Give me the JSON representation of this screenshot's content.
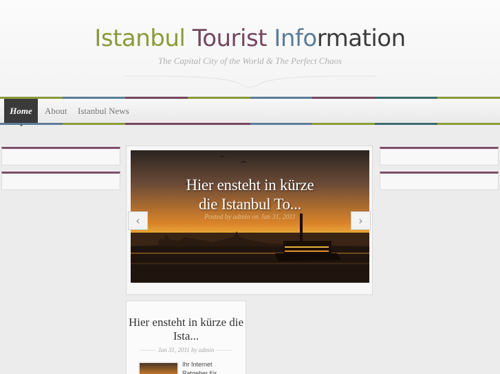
{
  "header": {
    "title_parts": [
      "Istanbul",
      "Tourist",
      "Info",
      "rmation"
    ],
    "tagline": "The Capital City of the World & The Perfect Chaos"
  },
  "nav": {
    "items": [
      {
        "label": "Home"
      },
      {
        "label": "About"
      },
      {
        "label": "Istanbul News"
      }
    ]
  },
  "slider": {
    "title_line1": "Hier ensteht in kürze",
    "title_line2": "die Istanbul To...",
    "meta": "Posted by admin on Jan 31, 2011",
    "prev_icon": "chevron-left-icon",
    "next_icon": "chevron-right-icon"
  },
  "post": {
    "title": "Hier ensteht in kürze die Ista...",
    "date": "Jan 31, 2011",
    "by": "by",
    "author": "admin",
    "excerpt": "Ihr Internet Ratgeber für"
  },
  "colors": {
    "green": "#8a9a3a",
    "purple": "#74465f",
    "blue": "#5b7c98",
    "dark": "#3a3a3a"
  }
}
